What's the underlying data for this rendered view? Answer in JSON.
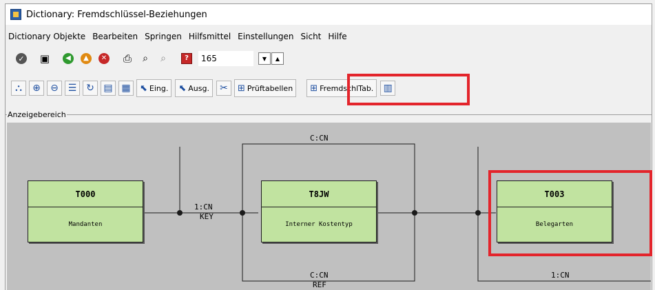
{
  "window": {
    "title": "Dictionary: Fremdschlüssel-Beziehungen"
  },
  "menu": [
    "Dictionary Objekte",
    "Bearbeiten",
    "Springen",
    "Hilfsmittel",
    "Einstellungen",
    "Sicht",
    "Hilfe"
  ],
  "toolbar1": {
    "page_value": "165"
  },
  "toolbar2": {
    "eing_label": "Eing.",
    "ausg_label": "Ausg.",
    "pruef_label": "Prüftabellen",
    "fremd_label": "FremdschlTab."
  },
  "group": {
    "label": "Anzeigebereich"
  },
  "diagram": {
    "nodes": [
      {
        "name": "T000",
        "desc": "Mandanten"
      },
      {
        "name": "T8JW",
        "desc": "Interner Kostentyp"
      },
      {
        "name": "T003",
        "desc": "Belegarten"
      }
    ],
    "labels": {
      "top_ccn": "C:CN",
      "mid_1cn": "1:CN",
      "mid_key": "KEY",
      "bottom_ccn": "C:CN",
      "bottom_ref": "REF",
      "right_1cn": "1:CN"
    }
  },
  "colors": {
    "highlight": "#e3242b",
    "node_fill": "#c1e3a0",
    "canvas": "#c0c0c0"
  }
}
